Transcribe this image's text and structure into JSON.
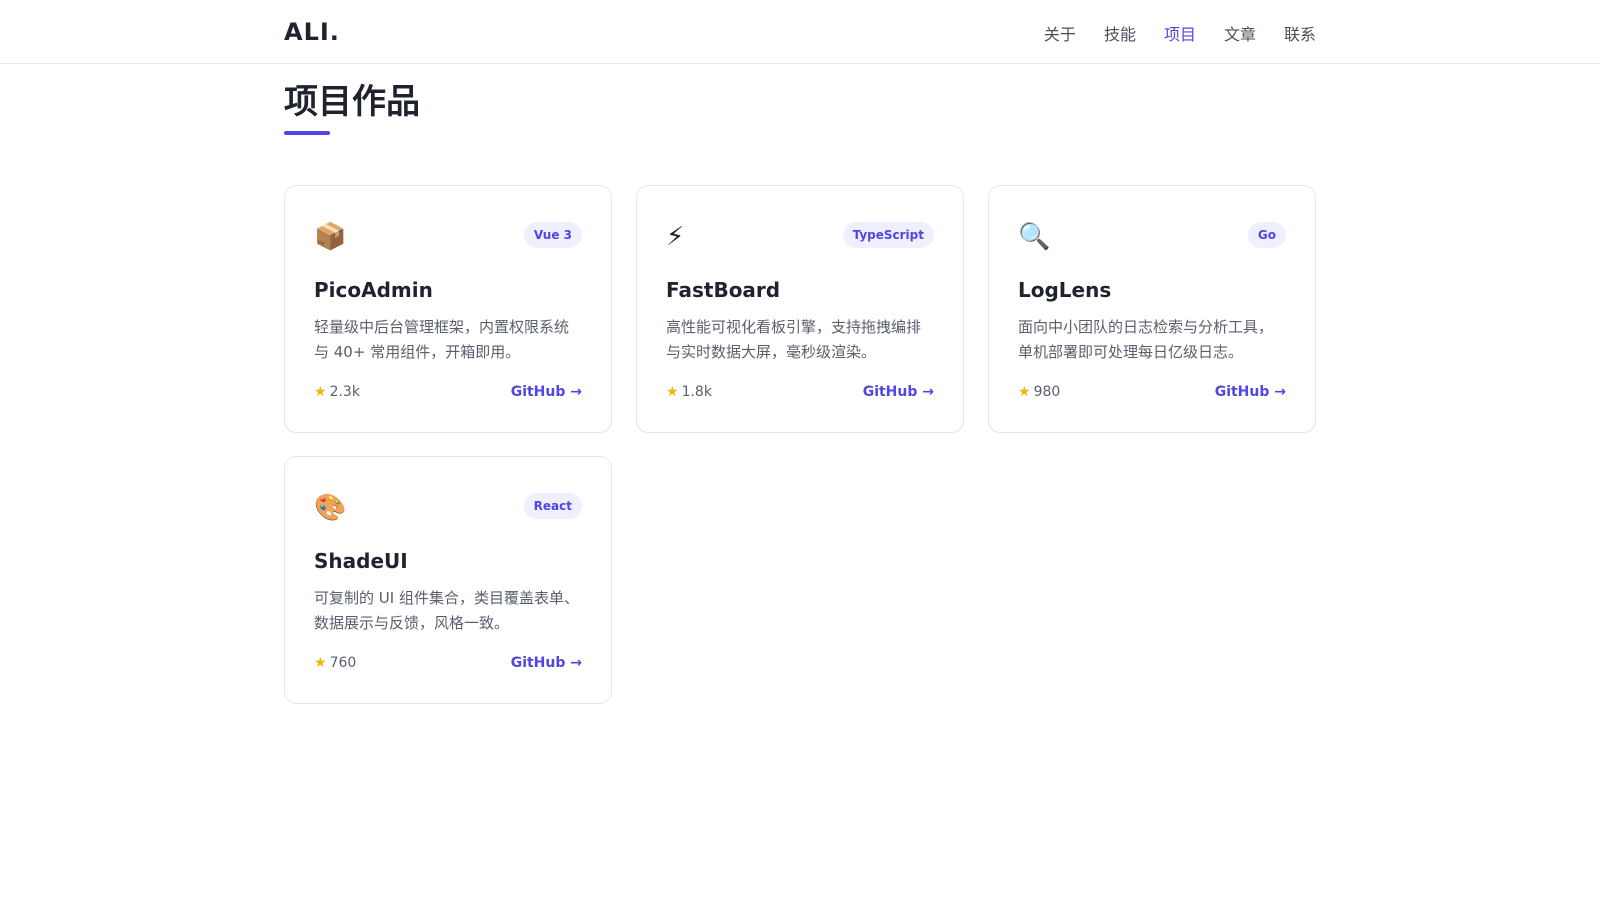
{
  "header": {
    "logo": "ALI.",
    "nav": [
      {
        "label": "关于",
        "active": false
      },
      {
        "label": "技能",
        "active": false
      },
      {
        "label": "项目",
        "active": true
      },
      {
        "label": "文章",
        "active": false
      },
      {
        "label": "联系",
        "active": false
      }
    ]
  },
  "section": {
    "title": "项目作品"
  },
  "colors": {
    "accent": "#4f46e5",
    "tag_bg": "#eef0fd",
    "star": "#f5b400"
  },
  "projects": [
    {
      "icon": "package-icon",
      "icon_glyph": "📦",
      "tag": "Vue 3",
      "name": "PicoAdmin",
      "desc": "轻量级中后台管理框架，内置权限系统与 40+ 常用组件，开箱即用。",
      "stars": "2.3k",
      "link": "GitHub →"
    },
    {
      "icon": "lightning-icon",
      "icon_glyph": "⚡",
      "tag": "TypeScript",
      "name": "FastBoard",
      "desc": "高性能可视化看板引擎，支持拖拽编排与实时数据大屏，毫秒级渲染。",
      "stars": "1.8k",
      "link": "GitHub →"
    },
    {
      "icon": "magnifier-icon",
      "icon_glyph": "🔍",
      "tag": "Go",
      "name": "LogLens",
      "desc": "面向中小团队的日志检索与分析工具，单机部署即可处理每日亿级日志。",
      "stars": "980",
      "link": "GitHub →"
    },
    {
      "icon": "palette-icon",
      "icon_glyph": "🎨",
      "tag": "React",
      "name": "ShadeUI",
      "desc": "可复制的 UI 组件集合，类目覆盖表单、数据展示与反馈，风格一致。",
      "stars": "760",
      "link": "GitHub →"
    }
  ]
}
